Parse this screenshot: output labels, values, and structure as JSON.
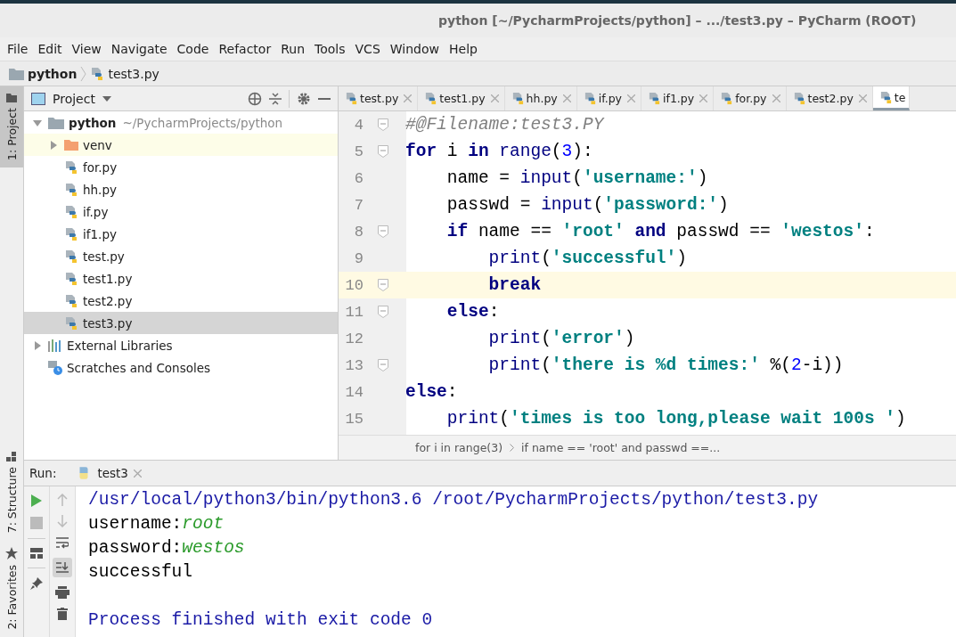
{
  "window": {
    "title": "python [~/PycharmProjects/python] – .../test3.py – PyCharm (ROOT)"
  },
  "menu": [
    "File",
    "Edit",
    "View",
    "Navigate",
    "Code",
    "Refactor",
    "Run",
    "Tools",
    "VCS",
    "Window",
    "Help"
  ],
  "navbar": [
    {
      "label": "python",
      "kind": "folder"
    },
    {
      "label": "test3.py",
      "kind": "file"
    }
  ],
  "tool_strip": {
    "top": [
      {
        "label": "1: Project",
        "selected": true
      }
    ],
    "bottom": [
      {
        "label": "7: Structure",
        "selected": false
      },
      {
        "label": "2: Favorites",
        "selected": false
      }
    ]
  },
  "project": {
    "title": "Project",
    "tree": [
      {
        "label": "python",
        "path": "~/PycharmProjects/python",
        "kind": "folder",
        "expanded": true,
        "selected": false,
        "children": [
          {
            "label": "venv",
            "kind": "venv",
            "expanded": false,
            "selected": false
          },
          {
            "label": "for.py",
            "kind": "file",
            "selected": false
          },
          {
            "label": "hh.py",
            "kind": "file",
            "selected": false
          },
          {
            "label": "if.py",
            "kind": "file",
            "selected": false
          },
          {
            "label": "if1.py",
            "kind": "file",
            "selected": false
          },
          {
            "label": "test.py",
            "kind": "file",
            "selected": false
          },
          {
            "label": "test1.py",
            "kind": "file",
            "selected": false
          },
          {
            "label": "test2.py",
            "kind": "file",
            "selected": false
          },
          {
            "label": "test3.py",
            "kind": "file",
            "selected": true
          }
        ]
      },
      {
        "label": "External Libraries",
        "kind": "libraries",
        "expanded": false,
        "selected": false
      },
      {
        "label": "Scratches and Consoles",
        "kind": "scratches",
        "selected": false
      }
    ]
  },
  "editor": {
    "tabs": [
      {
        "label": "test.py",
        "selected": false
      },
      {
        "label": "test1.py",
        "selected": false
      },
      {
        "label": "hh.py",
        "selected": false
      },
      {
        "label": "if.py",
        "selected": false
      },
      {
        "label": "if1.py",
        "selected": false
      },
      {
        "label": "for.py",
        "selected": false
      },
      {
        "label": "test2.py",
        "selected": false
      },
      {
        "label": "te",
        "selected": true
      }
    ],
    "lines": [
      {
        "number": "4",
        "fold": true,
        "current": false,
        "tokens": [
          {
            "kind": "comment",
            "text": "#@Filename:test3.PY"
          }
        ]
      },
      {
        "number": "5",
        "fold": true,
        "current": false,
        "tokens": [
          {
            "kind": "kw",
            "text": "for"
          },
          {
            "kind": "plain",
            "text": " i "
          },
          {
            "kind": "kw",
            "text": "in "
          },
          {
            "kind": "fn",
            "text": "range"
          },
          {
            "kind": "plain",
            "text": "("
          },
          {
            "kind": "num",
            "text": "3"
          },
          {
            "kind": "plain",
            "text": "):"
          }
        ]
      },
      {
        "number": "6",
        "fold": false,
        "current": false,
        "tokens": [
          {
            "kind": "plain",
            "text": "    name = "
          },
          {
            "kind": "fn",
            "text": "input"
          },
          {
            "kind": "plain",
            "text": "("
          },
          {
            "kind": "str",
            "text": "'username:'"
          },
          {
            "kind": "plain",
            "text": ")"
          }
        ]
      },
      {
        "number": "7",
        "fold": false,
        "current": false,
        "tokens": [
          {
            "kind": "plain",
            "text": "    passwd = "
          },
          {
            "kind": "fn",
            "text": "input"
          },
          {
            "kind": "plain",
            "text": "("
          },
          {
            "kind": "str",
            "text": "'password:'"
          },
          {
            "kind": "plain",
            "text": ")"
          }
        ]
      },
      {
        "number": "8",
        "fold": true,
        "current": false,
        "tokens": [
          {
            "kind": "kw",
            "text": "    if"
          },
          {
            "kind": "plain",
            "text": " name == "
          },
          {
            "kind": "str",
            "text": "'root'"
          },
          {
            "kind": "kw",
            "text": " and"
          },
          {
            "kind": "plain",
            "text": " passwd == "
          },
          {
            "kind": "str",
            "text": "'westos'"
          },
          {
            "kind": "plain",
            "text": ":"
          }
        ]
      },
      {
        "number": "9",
        "fold": false,
        "current": false,
        "tokens": [
          {
            "kind": "fn",
            "text": "        print"
          },
          {
            "kind": "plain",
            "text": "("
          },
          {
            "kind": "str",
            "text": "'successful'"
          },
          {
            "kind": "plain",
            "text": ")"
          }
        ]
      },
      {
        "number": "10",
        "fold": true,
        "current": true,
        "tokens": [
          {
            "kind": "kw",
            "text": "        break"
          }
        ]
      },
      {
        "number": "11",
        "fold": true,
        "current": false,
        "tokens": [
          {
            "kind": "kw",
            "text": "    else"
          },
          {
            "kind": "plain",
            "text": ":"
          }
        ]
      },
      {
        "number": "12",
        "fold": false,
        "current": false,
        "tokens": [
          {
            "kind": "fn",
            "text": "        print"
          },
          {
            "kind": "plain",
            "text": "("
          },
          {
            "kind": "str",
            "text": "'error'"
          },
          {
            "kind": "plain",
            "text": ")"
          }
        ]
      },
      {
        "number": "13",
        "fold": true,
        "current": false,
        "tokens": [
          {
            "kind": "fn",
            "text": "        print"
          },
          {
            "kind": "plain",
            "text": "("
          },
          {
            "kind": "str",
            "text": "'there is %d times:'"
          },
          {
            "kind": "plain",
            "text": " %("
          },
          {
            "kind": "num",
            "text": "2"
          },
          {
            "kind": "plain",
            "text": "-i))"
          }
        ]
      },
      {
        "number": "14",
        "fold": false,
        "current": false,
        "tokens": [
          {
            "kind": "kw",
            "text": "else"
          },
          {
            "kind": "plain",
            "text": ":"
          }
        ]
      },
      {
        "number": "15",
        "fold": false,
        "current": false,
        "tokens": [
          {
            "kind": "fn",
            "text": "    print"
          },
          {
            "kind": "plain",
            "text": "("
          },
          {
            "kind": "str",
            "text": "'times is too long,please wait 100s '"
          },
          {
            "kind": "plain",
            "text": ")"
          }
        ]
      }
    ],
    "breadcrumbs": [
      "for i in range(3)",
      "if name == 'root' and passwd ==..."
    ]
  },
  "run": {
    "label": "Run:",
    "tab": "test3",
    "output": [
      {
        "kind": "cmd",
        "parts": [
          {
            "kind": "out",
            "text": "/usr/local/python3/bin/python3.6 /root/PycharmProjects/python/test3.py"
          }
        ]
      },
      {
        "kind": "text",
        "parts": [
          {
            "kind": "out",
            "text": "username:"
          },
          {
            "kind": "input",
            "text": "root"
          }
        ]
      },
      {
        "kind": "text",
        "parts": [
          {
            "kind": "out",
            "text": "password:"
          },
          {
            "kind": "input",
            "text": "westos"
          }
        ]
      },
      {
        "kind": "text",
        "parts": [
          {
            "kind": "out",
            "text": "successful"
          }
        ]
      },
      {
        "kind": "exit",
        "parts": [
          {
            "kind": "out",
            "text": "Process finished with exit code 0"
          }
        ]
      }
    ]
  }
}
